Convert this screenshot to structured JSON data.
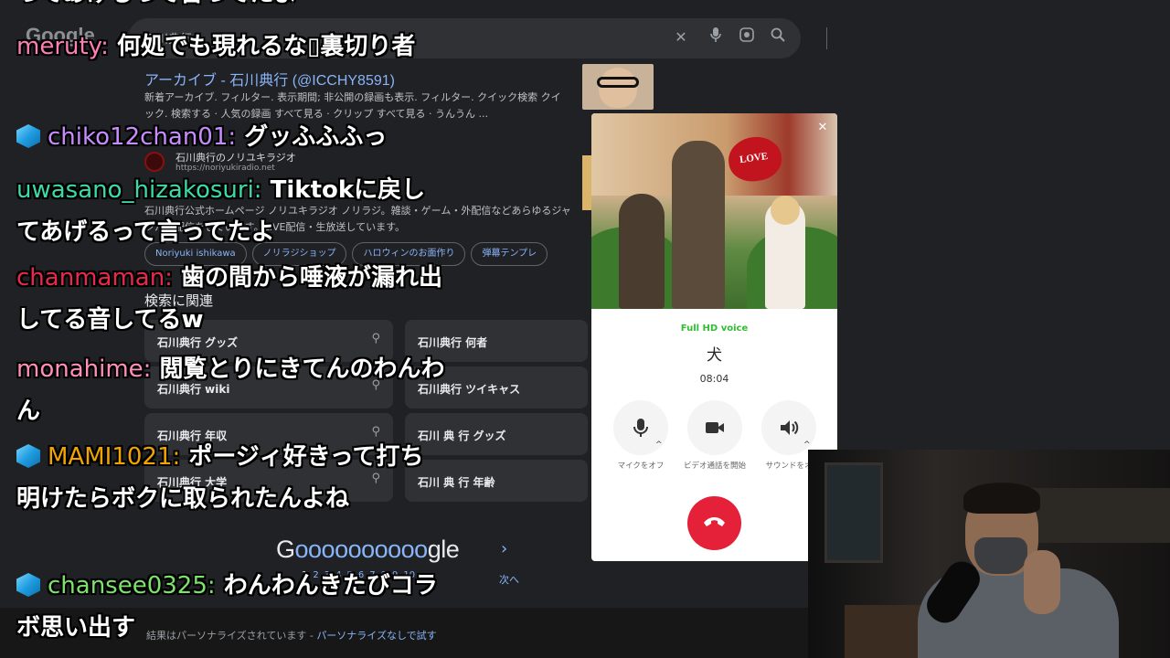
{
  "google": {
    "logo_small": "Google",
    "search_query": "石川典行",
    "result1": {
      "title": "アーカイブ - 石川典行 (@ICCHY8591)",
      "snippet": "新着アーカイブ. フィルター. 表示期間; 非公開の録画も表示. フィルター. クイック検索 クイック. 検索する · 人気の録画 すべて見る · クリップ すべて見る · うんうん ..."
    },
    "result2": {
      "site_name": "石川典行のノリユキラジオ",
      "site_url": "https://noriyukiradio.net",
      "snippet": "石川典行公式ホームページ ノリユキラジオ ノリラジ。雑談・ゲーム・外配信などあらゆるジャンルの配信をしています。LIVE配信・生放送しています。",
      "chips": [
        "Noriyuki ishikawa",
        "ノリラジショップ",
        "ハロウィンのお面作り",
        "弾幕テンプレ"
      ]
    },
    "related_heading": "検索に関連",
    "related": [
      "石川典行 グッズ",
      "石川典行 何者",
      "石川典行 wiki",
      "石川典行 ツイキャス",
      "石川典行 年収",
      "石川 典 行 グッズ",
      "石川典行 大学",
      "石川 典 行 年齢"
    ],
    "pager_logo_start": "G",
    "pager_logo_os": "oooooooooo",
    "pager_logo_end": "gle",
    "pager_pages": [
      "1",
      "2",
      "3",
      "4",
      "5",
      "6",
      "7",
      "8",
      "9",
      "10"
    ],
    "pager_next": "次へ",
    "footer_text": "結果はパーソナライズされています - ",
    "footer_link": "パーソナライズなしで試す"
  },
  "call": {
    "quality": "Full HD voice",
    "name": "犬",
    "duration": "08:04",
    "heart_text": "LOVE",
    "buttons": {
      "mic_label": "マイクをオフ",
      "video_label": "ビデオ通話を開始",
      "speaker_label": "サウンドをオ"
    },
    "accent": "#e5213a"
  },
  "chat": {
    "top_fragment": "ってあげるって言ってたよ",
    "messages": [
      {
        "user": "meruty:",
        "text": "何処でも現れるな▯裏切り者",
        "user_color": "#ff7eb3",
        "has_icon": false
      },
      {
        "user": "chiko12chan01:",
        "text": "グッふふふっ",
        "user_color": "#c88cff",
        "has_icon": true
      },
      {
        "user": "uwasano_hizakosuri:",
        "text": "Tiktokに戻してあげるって言ってたよ",
        "user_color": "#3dd9a6",
        "has_icon": false
      },
      {
        "user": "chanmaman:",
        "text": "歯の間から唾液が漏れ出してる音してるw",
        "user_color": "#e8294a",
        "has_icon": false
      },
      {
        "user": "monahime:",
        "text": "閲覧とりにきてんのわんわん",
        "user_color": "#ff8fb8",
        "has_icon": false
      },
      {
        "user": "MAMI1021:",
        "text": "ポージィ好きって打ち明けたらボクに取られたんよね",
        "user_color": "#f2a500",
        "has_icon": true
      },
      {
        "user": "chansee0325:",
        "text": "わんわんきたびコラボ思い出す",
        "user_color": "#7ce36a",
        "has_icon": true
      }
    ]
  }
}
